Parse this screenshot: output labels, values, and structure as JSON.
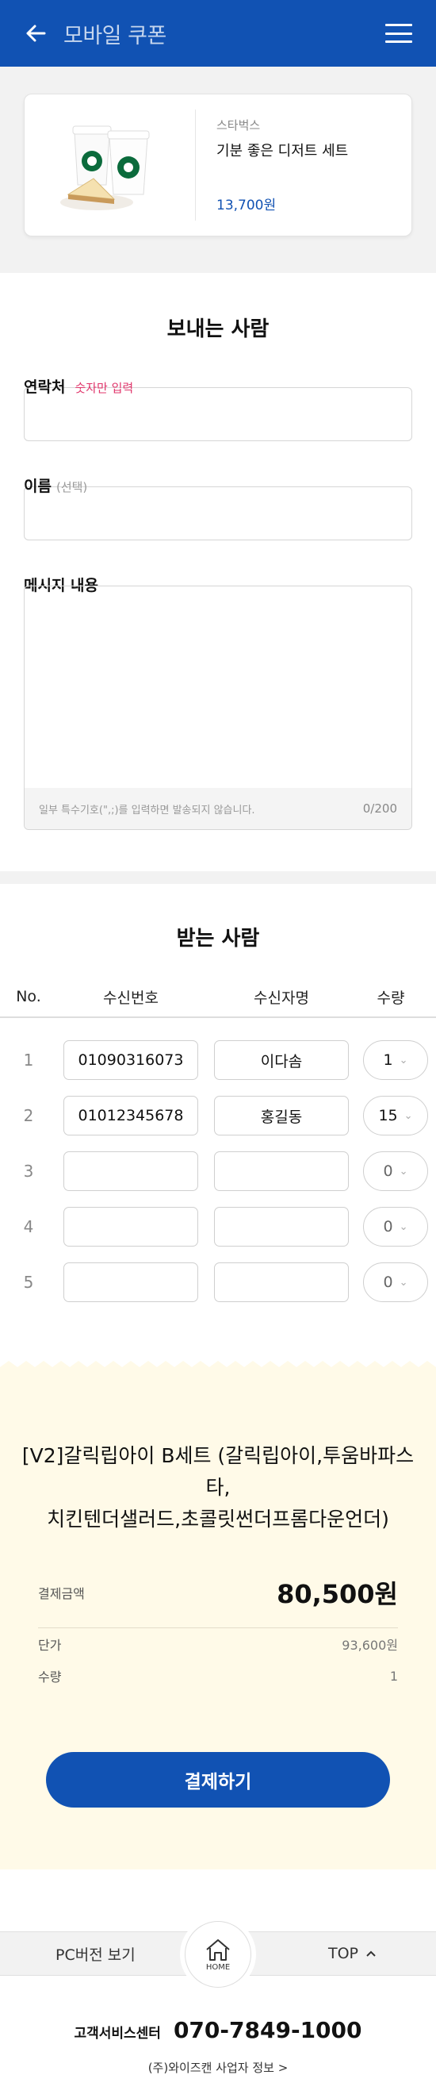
{
  "header": {
    "title": "모바일 쿠폰"
  },
  "product": {
    "brand": "스타벅스",
    "name": "기분 좋은 디저트 세트",
    "price": "13,700원",
    "image_alt": "coffee-cups-and-cheesecake"
  },
  "sender": {
    "title": "보내는 사람",
    "contact_label": "연락처",
    "contact_hint": "숫자만 입력",
    "name_label": "이름",
    "name_hint": "(선택)",
    "message_label": "메시지 내용",
    "message_notice": "일부 특수기호(\",;)를 입력하면 발송되지 않습니다.",
    "message_count": "0/200"
  },
  "receiver": {
    "title": "받는 사람",
    "columns": {
      "no": "No.",
      "number": "수신번호",
      "name": "수신자명",
      "qty": "수량"
    },
    "rows": [
      {
        "no": "1",
        "number": "01090316073",
        "name": "이다솜",
        "qty": "1"
      },
      {
        "no": "2",
        "number": "01012345678",
        "name": "홍길동",
        "qty": "15"
      },
      {
        "no": "3",
        "number": "",
        "name": "",
        "qty": "0"
      },
      {
        "no": "4",
        "number": "",
        "name": "",
        "qty": "0"
      },
      {
        "no": "5",
        "number": "",
        "name": "",
        "qty": "0"
      }
    ]
  },
  "order": {
    "title_line1": "[V2]갈릭립아이 B세트 (갈릭립아이,투움바파스타,",
    "title_line2": "치킨텐더샐러드,초콜릿썬더프롬다운언더)",
    "pay_label": "결제금액",
    "pay_amount": "80,500원",
    "unit_price_label": "단가",
    "unit_price": "93,600원",
    "quantity_label": "수량",
    "quantity": "1",
    "pay_button": "결제하기"
  },
  "footer": {
    "pc_version": "PC버전 보기",
    "home_label": "HOME",
    "top_label": "TOP",
    "cs_label": "고객서비스센터",
    "cs_phone": "070-7849-1000",
    "business_info": "(주)와이즈캔 사업자 정보 >"
  },
  "colors": {
    "brand_blue": "#1152b3",
    "hint_pink": "#e0356b",
    "order_bg": "#fffae8"
  }
}
